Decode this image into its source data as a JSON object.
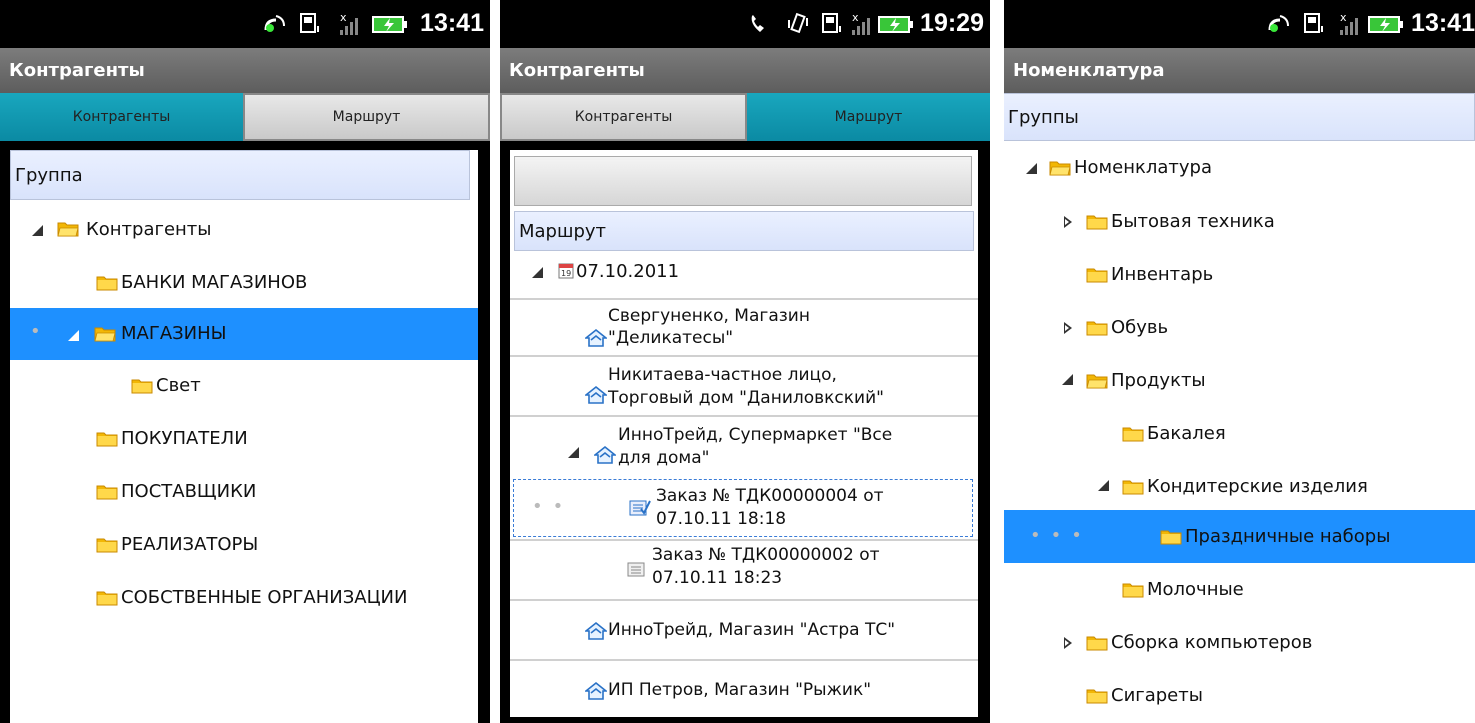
{
  "screen1": {
    "time": "13:41",
    "title": "Контрагенты",
    "tabs": [
      "Контрагенты",
      "Маршрут"
    ],
    "header": "Группа",
    "items": [
      "Контрагенты",
      "БАНКИ МАГАЗИНОВ",
      "МАГАЗИНЫ",
      "Свет",
      "ПОКУПАТЕЛИ",
      "ПОСТАВЩИКИ",
      "РЕАЛИЗАТОРЫ",
      "СОБСТВЕННЫЕ ОРГАНИЗАЦИИ"
    ]
  },
  "screen2": {
    "time": "19:29",
    "title": "Контрагенты",
    "tabs": [
      "Контрагенты",
      "Маршрут"
    ],
    "header": "Маршрут",
    "date": "07.10.2011",
    "items": [
      {
        "line1": "Свергуненко, Магазин",
        "line2": "\"Деликатесы\""
      },
      {
        "line1": "Никитаева-частное лицо,",
        "line2": "Торговый дом \"Даниловкский\""
      },
      {
        "line1": "ИнноТрейд, Супермаркет \"Все",
        "line2": "для дома\""
      },
      {
        "line1": "Заказ № ТДК00000004 от",
        "line2": "07.10.11 18:18"
      },
      {
        "line1": "Заказ № ТДК00000002 от",
        "line2": "07.10.11 18:23"
      },
      {
        "line1": "ИнноТрейд, Магазин \"Астра ТС\""
      },
      {
        "line1": "ИП Петров, Магазин \"Рыжик\""
      }
    ]
  },
  "screen3": {
    "time": "13:41",
    "title": "Номенклатура",
    "header": "Группы",
    "items": [
      "Номенклатура",
      "Бытовая техника",
      "Инвентарь",
      "Обувь",
      "Продукты",
      "Бакалея",
      "Кондитерские изделия",
      "Праздничные наборы",
      "Молочные",
      "Сборка компьютеров",
      "Сигареты"
    ]
  },
  "colors": {
    "tab_active": "#0b8aa3",
    "selection": "#1e90ff",
    "header_bg": "#dfe7fc",
    "folder": "#f5c518"
  }
}
